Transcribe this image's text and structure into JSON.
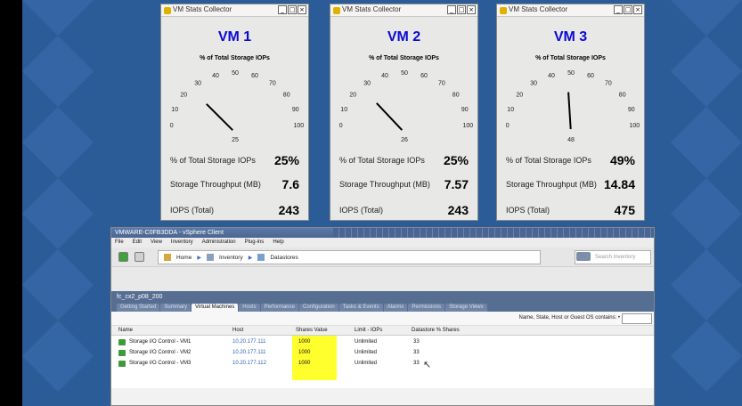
{
  "vm_windows": [
    {
      "title": "VM Stats Collector",
      "vm_name": "VM 1",
      "gauge_title": "% of Total Storage IOPs",
      "gauge_scale": [
        "0",
        "10",
        "20",
        "30",
        "40",
        "50",
        "60",
        "70",
        "80",
        "90",
        "100"
      ],
      "gauge_value": 25,
      "gauge_value_label": "25",
      "metrics": [
        {
          "label": "% of Total Storage IOPs",
          "value": "25%"
        },
        {
          "label": "Storage Throughput (MB)",
          "value": "7.6"
        },
        {
          "label": "IOPS (Total)",
          "value": "243"
        }
      ]
    },
    {
      "title": "VM Stats Collector",
      "vm_name": "VM 2",
      "gauge_title": "% of Total Storage IOPs",
      "gauge_scale": [
        "0",
        "10",
        "20",
        "30",
        "40",
        "50",
        "60",
        "70",
        "80",
        "90",
        "100"
      ],
      "gauge_value": 26,
      "gauge_value_label": "26",
      "metrics": [
        {
          "label": "% of Total Storage IOPs",
          "value": "25%"
        },
        {
          "label": "Storage Throughput (MB)",
          "value": "7.57"
        },
        {
          "label": "IOPS (Total)",
          "value": "243"
        }
      ]
    },
    {
      "title": "VM Stats Collector",
      "vm_name": "VM 3",
      "gauge_title": "% of Total Storage IOPs",
      "gauge_scale": [
        "0",
        "10",
        "20",
        "30",
        "40",
        "50",
        "60",
        "70",
        "80",
        "90",
        "100"
      ],
      "gauge_value": 48,
      "gauge_value_label": "48",
      "metrics": [
        {
          "label": "% of Total Storage IOPs",
          "value": "49%"
        },
        {
          "label": "Storage Throughput (MB)",
          "value": "14.84"
        },
        {
          "label": "IOPS (Total)",
          "value": "475"
        }
      ]
    }
  ],
  "vsphere": {
    "title": "VMWARE-C0FB3DDA - vSphere Client",
    "menu": [
      "File",
      "Edit",
      "View",
      "Inventory",
      "Administration",
      "Plug-ins",
      "Help"
    ],
    "breadcrumb": [
      "Home",
      "Inventory",
      "Datastores"
    ],
    "search_placeholder": "Search Inventory",
    "object_name": "fc_cx2_p08_200",
    "tabs": [
      "Getting Started",
      "Summary",
      "Virtual Machines",
      "Hosts",
      "Performance",
      "Configuration",
      "Tasks & Events",
      "Alarms",
      "Permissions",
      "Storage Views"
    ],
    "active_tab": "Virtual Machines",
    "filter_label": "Name, State, Host or Guest OS contains: •",
    "columns": [
      "Name",
      "Host",
      "Shares Value",
      "Limit - IOPs",
      "Datastore % Shares"
    ],
    "rows": [
      {
        "name": "Storage I/O Control - VM1",
        "host": "10.20.177.111",
        "shares": "1000",
        "limit": "Unlimited",
        "pct": "33"
      },
      {
        "name": "Storage I/O Control - VM2",
        "host": "10.20.177.111",
        "shares": "1000",
        "limit": "Unlimited",
        "pct": "33"
      },
      {
        "name": "Storage I/O Control - VM3",
        "host": "10.20.177.112",
        "shares": "1000",
        "limit": "Unlimited",
        "pct": "33"
      }
    ],
    "highlight_color": "#ffff2e"
  },
  "colors": {
    "background": "#2a5a96",
    "vm_name": "#0a0ad6",
    "host_link": "#2a62b0"
  }
}
